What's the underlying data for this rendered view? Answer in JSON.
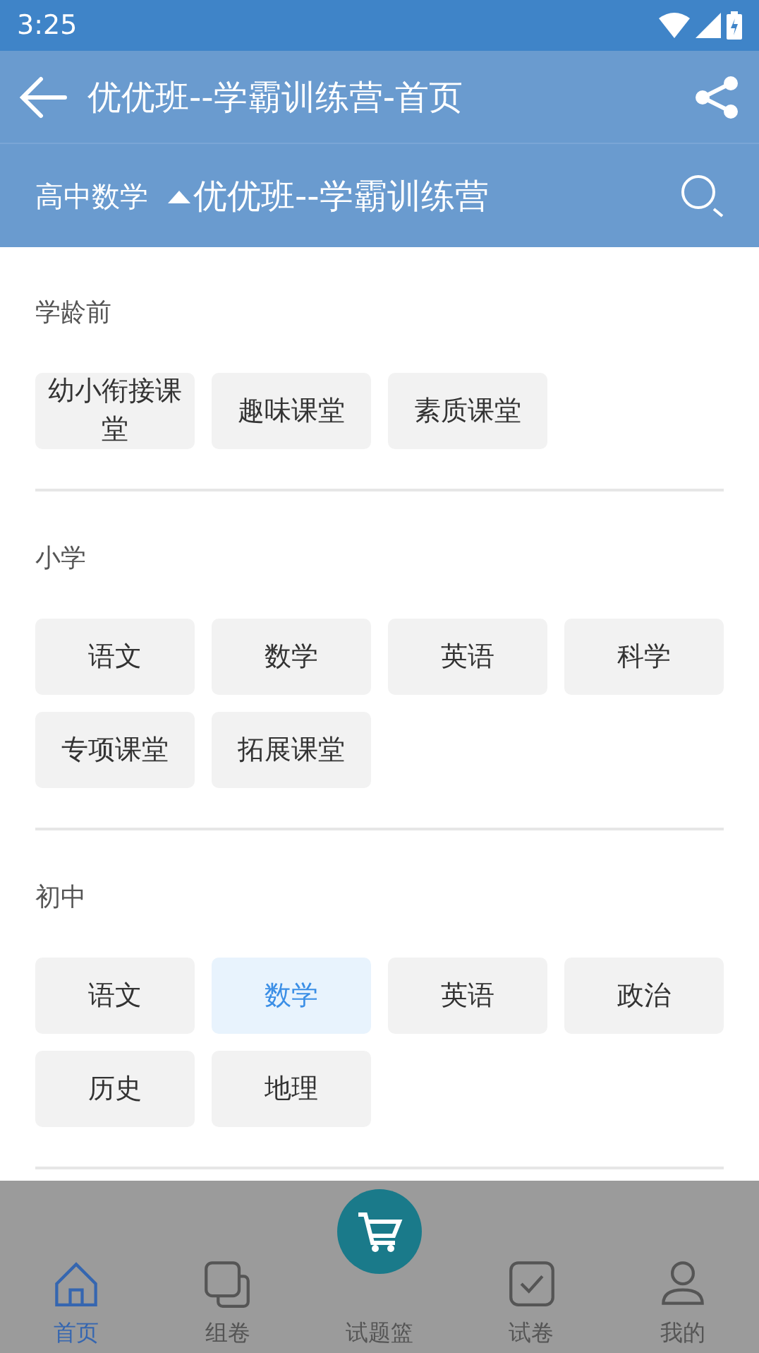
{
  "status_bar": {
    "time": "3:25"
  },
  "app_bar": {
    "title": "优优班--学霸训练营-首页"
  },
  "filter_bar": {
    "subject": "高中数学",
    "class_picker": "优优班--学霸训练营",
    "expanded": true
  },
  "sections": [
    {
      "heading": "学龄前",
      "chips": [
        {
          "label": "幼小衔接课堂",
          "selected": false
        },
        {
          "label": "趣味课堂",
          "selected": false
        },
        {
          "label": "素质课堂",
          "selected": false
        }
      ]
    },
    {
      "heading": "小学",
      "chips": [
        {
          "label": "语文",
          "selected": false
        },
        {
          "label": "数学",
          "selected": false
        },
        {
          "label": "英语",
          "selected": false
        },
        {
          "label": "科学",
          "selected": false
        },
        {
          "label": "专项课堂",
          "selected": false
        },
        {
          "label": "拓展课堂",
          "selected": false
        }
      ]
    },
    {
      "heading": "初中",
      "chips": [
        {
          "label": "语文",
          "selected": false
        },
        {
          "label": "数学",
          "selected": true
        },
        {
          "label": "英语",
          "selected": false
        },
        {
          "label": "政治",
          "selected": false
        },
        {
          "label": "历史",
          "selected": false
        },
        {
          "label": "地理",
          "selected": false
        }
      ]
    }
  ],
  "bottom_nav": [
    {
      "label": "首页",
      "kind": "home",
      "selected": true
    },
    {
      "label": "组卷",
      "kind": "stack",
      "selected": false
    },
    {
      "label": "试题篮",
      "kind": "cart",
      "selected": false
    },
    {
      "label": "试卷",
      "kind": "check",
      "selected": false
    },
    {
      "label": "我的",
      "kind": "user",
      "selected": false
    }
  ]
}
